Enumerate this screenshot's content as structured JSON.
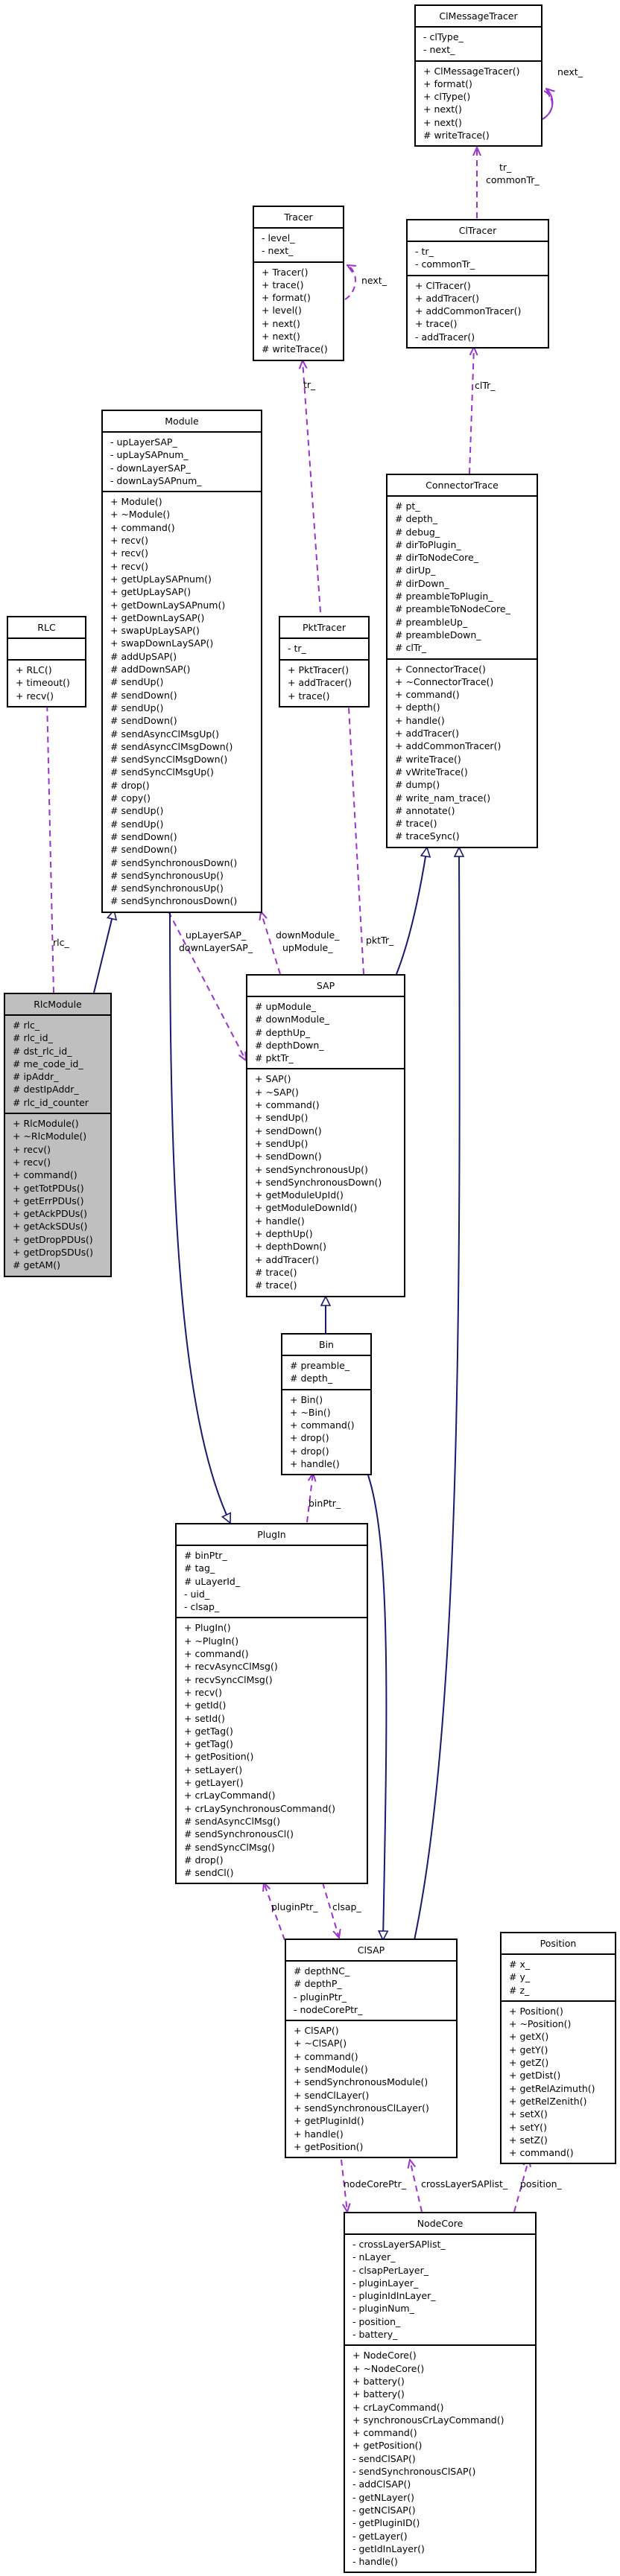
{
  "diagram": {
    "type": "uml-class-collaboration",
    "classes": {
      "clmessagetracer": {
        "name": "ClMessageTracer",
        "attributes": [
          "- clType_",
          "- next_"
        ],
        "methods": [
          "+ ClMessageTracer()",
          "+ format()",
          "+ clType()",
          "+ next()",
          "+ next()",
          "# writeTrace()"
        ]
      },
      "tracer": {
        "name": "Tracer",
        "attributes": [
          "- level_",
          "- next_"
        ],
        "methods": [
          "+ Tracer()",
          "+ trace()",
          "+ format()",
          "+ level()",
          "+ next()",
          "+ next()",
          "# writeTrace()"
        ]
      },
      "cltracer": {
        "name": "ClTracer",
        "attributes": [
          "- tr_",
          "- commonTr_"
        ],
        "methods": [
          "+ ClTracer()",
          "+ addTracer()",
          "+ addCommonTracer()",
          "+ trace()",
          "- addTracer()"
        ]
      },
      "module": {
        "name": "Module",
        "attributes": [
          "- upLayerSAP_",
          "- upLaySAPnum_",
          "- downLayerSAP_",
          "- downLaySAPnum_"
        ],
        "methods": [
          "+ Module()",
          "+ ~Module()",
          "+ command()",
          "+ recv()",
          "+ recv()",
          "+ recv()",
          "+ getUpLaySAPnum()",
          "+ getUpLaySAP()",
          "+ getDownLaySAPnum()",
          "+ getDownLaySAP()",
          "+ swapUpLaySAP()",
          "+ swapDownLaySAP()",
          "# addUpSAP()",
          "# addDownSAP()",
          "# sendUp()",
          "# sendDown()",
          "# sendUp()",
          "# sendDown()",
          "# sendAsyncClMsgUp()",
          "# sendAsyncClMsgDown()",
          "# sendSyncClMsgDown()",
          "# sendSyncClMsgUp()",
          "# drop()",
          "# copy()",
          "# sendUp()",
          "# sendUp()",
          "# sendDown()",
          "# sendDown()",
          "# sendSynchronousDown()",
          "# sendSynchronousUp()",
          "# sendSynchronousUp()",
          "# sendSynchronousDown()"
        ]
      },
      "rlc": {
        "name": "RLC",
        "attributes": [],
        "methods": [
          "+ RLC()",
          "+ timeout()",
          "+ recv()"
        ]
      },
      "pkttracer": {
        "name": "PktTracer",
        "attributes": [
          "- tr_"
        ],
        "methods": [
          "+ PktTracer()",
          "+ addTracer()",
          "+ trace()"
        ]
      },
      "connectortrace": {
        "name": "ConnectorTrace",
        "attributes": [
          "# pt_",
          "# depth_",
          "# debug_",
          "# dirToPlugin_",
          "# dirToNodeCore_",
          "# dirUp_",
          "# dirDown_",
          "# preambleToPlugin_",
          "# preambleToNodeCore_",
          "# preambleUp_",
          "# preambleDown_",
          "# clTr_"
        ],
        "methods": [
          "+ ConnectorTrace()",
          "+ ~ConnectorTrace()",
          "+ command()",
          "+ depth()",
          "+ handle()",
          "+ addTracer()",
          "+ addCommonTracer()",
          "# writeTrace()",
          "# vWriteTrace()",
          "# dump()",
          "# write_nam_trace()",
          "# annotate()",
          "# trace()",
          "# traceSync()"
        ]
      },
      "rlcmodule": {
        "name": "RlcModule",
        "attributes": [
          "# rlc_",
          "# rlc_id_",
          "# dst_rlc_id_",
          "# me_code_id_",
          "# ipAddr_",
          "# destIpAddr_",
          "# rlc_id_counter"
        ],
        "methods": [
          "+ RlcModule()",
          "+ ~RlcModule()",
          "+ recv()",
          "+ recv()",
          "+ command()",
          "+ getTotPDUs()",
          "+ getErrPDUs()",
          "+ getAckPDUs()",
          "+ getAckSDUs()",
          "+ getDropPDUs()",
          "+ getDropSDUs()",
          "# getAM()"
        ]
      },
      "sap": {
        "name": "SAP",
        "attributes": [
          "# upModule_",
          "# downModule_",
          "# depthUp_",
          "# depthDown_",
          "# pktTr_"
        ],
        "methods": [
          "+ SAP()",
          "+ ~SAP()",
          "+ command()",
          "+ sendUp()",
          "+ sendDown()",
          "+ sendUp()",
          "+ sendDown()",
          "+ sendSynchronousUp()",
          "+ sendSynchronousDown()",
          "+ getModuleUpId()",
          "+ getModuleDownId()",
          "+ handle()",
          "+ depthUp()",
          "+ depthDown()",
          "+ addTracer()",
          "# trace()",
          "# trace()"
        ]
      },
      "bin": {
        "name": "Bin",
        "attributes": [
          "# preamble_",
          "# depth_"
        ],
        "methods": [
          "+ Bin()",
          "+ ~Bin()",
          "+ command()",
          "+ drop()",
          "+ drop()",
          "+ handle()"
        ]
      },
      "plugin": {
        "name": "PlugIn",
        "attributes": [
          "# binPtr_",
          "# tag_",
          "# uLayerId_",
          "- uid_",
          "- clsap_"
        ],
        "methods": [
          "+ PlugIn()",
          "+ ~PlugIn()",
          "+ command()",
          "+ recvAsyncClMsg()",
          "+ recvSyncClMsg()",
          "+ recv()",
          "+ getId()",
          "+ setId()",
          "+ getTag()",
          "+ getTag()",
          "+ getPosition()",
          "+ setLayer()",
          "+ getLayer()",
          "+ crLayCommand()",
          "+ crLaySynchronousCommand()",
          "# sendAsyncClMsg()",
          "# sendSynchronousCl()",
          "# sendSyncClMsg()",
          "# drop()",
          "# sendCl()"
        ]
      },
      "clsap": {
        "name": "ClSAP",
        "attributes": [
          "# depthNC_",
          "# depthP_",
          "- pluginPtr_",
          "- nodeCorePtr_"
        ],
        "methods": [
          "+ ClSAP()",
          "+ ~ClSAP()",
          "+ command()",
          "+ sendModule()",
          "+ sendSynchronousModule()",
          "+ sendClLayer()",
          "+ sendSynchronousClLayer()",
          "+ getPluginId()",
          "+ handle()",
          "+ getPosition()"
        ]
      },
      "position": {
        "name": "Position",
        "attributes": [
          "# x_",
          "# y_",
          "# z_"
        ],
        "methods": [
          "+ Position()",
          "+ ~Position()",
          "+ getX()",
          "+ getY()",
          "+ getZ()",
          "+ getDist()",
          "+ getRelAzimuth()",
          "+ getRelZenith()",
          "+ setX()",
          "+ setY()",
          "+ setZ()",
          "+ command()"
        ]
      },
      "nodecore": {
        "name": "NodeCore",
        "attributes": [
          "- crossLayerSAPlist_",
          "- nLayer_",
          "- clsapPerLayer_",
          "- pluginLayer_",
          "- pluginIdInLayer_",
          "- pluginNum_",
          "- position_",
          "- battery_"
        ],
        "methods": [
          "+ NodeCore()",
          "+ ~NodeCore()",
          "+ battery()",
          "+ battery()",
          "+ crLayCommand()",
          "+ synchronousCrLayCommand()",
          "+ command()",
          "+ getPosition()",
          "- sendClSAP()",
          "- sendSynchronousClSAP()",
          "- addClSAP()",
          "- getNLayer()",
          "- getNClSAP()",
          "- getPluginID()",
          "- getLayer()",
          "- getIdInLayer()",
          "- handle()"
        ]
      }
    },
    "edge_labels": {
      "clmsg_self": "next_",
      "tracer_self": "next_",
      "cltracer_tr": "tr_\ncommonTr_",
      "connector_cltr": "clTr_",
      "pkt_tracer": "tr_",
      "rlc_rlcmodule": "rlc_",
      "module_sap": "upLayerSAP_\ndownLayerSAP_",
      "sap_module": "downModule_\nupModule_",
      "sap_pkttracer": "pktTr_",
      "bin_plugin": "binPtr_",
      "plugin_clsap": "pluginPtr_",
      "clsap_plugin": "clsap_",
      "clsap_nodecore": "nodeCorePtr_",
      "nodecore_clsap": "crossLayerSAPlist_",
      "nodecore_position": "position_"
    },
    "colors": {
      "usage_edge": "#9a32cd",
      "inheritance_edge": "#191970",
      "highlight_fill": "#bfbfbf"
    }
  }
}
